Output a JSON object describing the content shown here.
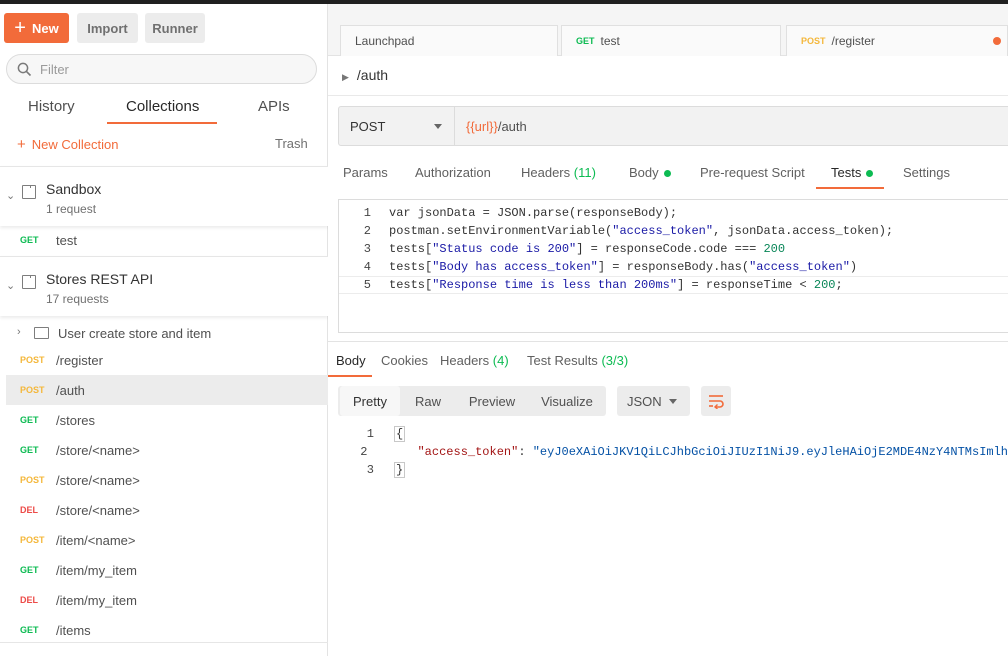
{
  "toolbar": {
    "new_label": "New",
    "import_label": "Import",
    "runner_label": "Runner"
  },
  "sidebar": {
    "filter_placeholder": "Filter",
    "tabs": [
      {
        "label": "History"
      },
      {
        "label": "Collections"
      },
      {
        "label": "APIs"
      }
    ],
    "new_collection_label": "New Collection",
    "trash_label": "Trash",
    "collections": [
      {
        "name": "Sandbox",
        "count": "1 request"
      },
      {
        "name": "Stores REST API",
        "count": "17 requests"
      }
    ],
    "sandbox_request": {
      "method": "GET",
      "path": "test"
    },
    "folder_name": "User create store and item",
    "requests": [
      {
        "method": "POST",
        "path": "/register"
      },
      {
        "method": "POST",
        "path": "/auth"
      },
      {
        "method": "GET",
        "path": "/stores"
      },
      {
        "method": "GET",
        "path": "/store/<name>"
      },
      {
        "method": "POST",
        "path": "/store/<name>"
      },
      {
        "method": "DEL",
        "path": "/store/<name>"
      },
      {
        "method": "POST",
        "path": "/item/<name>"
      },
      {
        "method": "GET",
        "path": "/item/my_item"
      },
      {
        "method": "DEL",
        "path": "/item/my_item"
      },
      {
        "method": "GET",
        "path": "/items"
      }
    ]
  },
  "request_tabs": [
    {
      "method": "",
      "label": "Launchpad"
    },
    {
      "method": "GET",
      "label": "test"
    },
    {
      "method": "POST",
      "label": "/register"
    }
  ],
  "breadcrumb": "/auth",
  "url_bar": {
    "method": "POST",
    "url_var": "{{url}}",
    "url_path": "/auth"
  },
  "req_section_tabs": {
    "params": "Params",
    "authorization": "Authorization",
    "headers": "Headers",
    "headers_count": "(11)",
    "body": "Body",
    "prerequest": "Pre-request Script",
    "tests": "Tests",
    "settings": "Settings"
  },
  "test_script": {
    "line_numbers": [
      "1",
      "2",
      "3",
      "4",
      "5"
    ],
    "l1": [
      "var jsonData = JSON.parse(responseBody);"
    ],
    "l2": [
      "postman.setEnvironmentVariable(",
      "\"access_token\"",
      ", jsonData.access_token);"
    ],
    "l3": [
      "tests[",
      "\"Status code is 200\"",
      "] = responseCode.code === ",
      "200"
    ],
    "l4": [
      "tests[",
      "\"Body has access_token\"",
      "] = responseBody.has(",
      "\"access_token\"",
      ")"
    ],
    "l5": [
      "tests[",
      "\"Response time is less than 200ms\"",
      "] = responseTime < ",
      "200",
      ";"
    ]
  },
  "response_tabs": {
    "body": "Body",
    "cookies": "Cookies",
    "headers": "Headers",
    "headers_count": "(4)",
    "test_results": "Test Results",
    "test_results_count": "(3/3)"
  },
  "view_buttons": [
    "Pretty",
    "Raw",
    "Preview",
    "Visualize"
  ],
  "format": "JSON",
  "response_body": {
    "line_numbers": [
      "1",
      "2",
      "3"
    ],
    "open": "{",
    "key": "\"access_token\"",
    "sep": ": ",
    "value": "\"eyJ0eXAiOiJKV1QiLCJhbGciOiJIUzI1NiJ9.eyJleHAiOjE2MDE4NzY4NTMsImlh",
    "close": "}"
  },
  "colors": {
    "accent": "#f26b3a",
    "get": "#0cbb52",
    "post": "#f4b73a",
    "delete": "#ed4b48"
  }
}
